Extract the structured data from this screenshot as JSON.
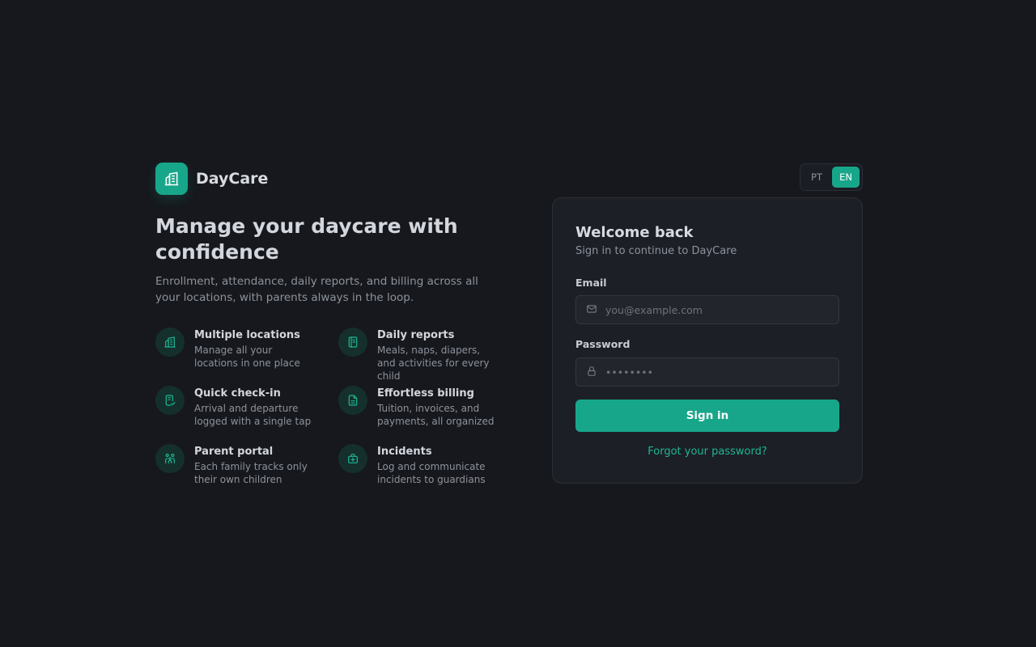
{
  "brand": {
    "name": "DayCare",
    "icon": "building-icon",
    "accent": "#18a68a"
  },
  "hero": {
    "title": "Manage your daycare with confidence",
    "subtitle": "Enrollment, attendance, daily reports, and billing across all your locations, with parents always in the loop."
  },
  "features": [
    {
      "icon": "building-icon",
      "title": "Multiple locations",
      "desc": "Manage all your locations in one place"
    },
    {
      "icon": "notebook-icon",
      "title": "Daily reports",
      "desc": "Meals, naps, diapers, and activities for every child"
    },
    {
      "icon": "clipboard-check-icon",
      "title": "Quick check-in",
      "desc": "Arrival and departure logged with a single tap"
    },
    {
      "icon": "invoice-icon",
      "title": "Effortless billing",
      "desc": "Tuition, invoices, and payments, all organized"
    },
    {
      "icon": "family-icon",
      "title": "Parent portal",
      "desc": "Each family tracks only their own children"
    },
    {
      "icon": "first-aid-icon",
      "title": "Incidents",
      "desc": "Log and communicate incidents to guardians"
    }
  ],
  "language": {
    "options": [
      "PT",
      "EN"
    ],
    "selected": "EN"
  },
  "login": {
    "title": "Welcome back",
    "subtitle": "Sign in to continue to DayCare",
    "email_label": "Email",
    "email_placeholder": "you@example.com",
    "email_value": "",
    "password_label": "Password",
    "password_value": "••••••••",
    "submit_label": "Sign in",
    "forgot_label": "Forgot your password?"
  }
}
